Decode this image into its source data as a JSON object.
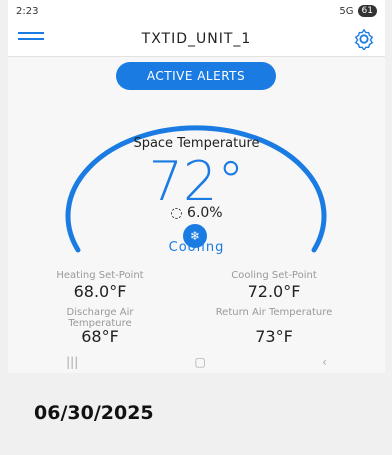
{
  "status_bar": {
    "time": "2:23",
    "signal": "5G",
    "battery": "61"
  },
  "header": {
    "title": "TXTID_UNIT_1"
  },
  "alerts_button": "ACTIVE ALERTS",
  "space": {
    "label": "Space Temperature",
    "temp": "72°",
    "humidity": "6.0%"
  },
  "mode": {
    "label": "Cooling"
  },
  "setpoints": {
    "heating_label": "Heating Set-Point",
    "heating_value": "68.0°F",
    "cooling_label": "Cooling Set-Point",
    "cooling_value": "72.0°F",
    "discharge_label": "Discharge Air Temperature",
    "discharge_value": "68°F",
    "return_label": "Return Air Temperature",
    "return_value": "73°F"
  },
  "date": "06/30/2025",
  "colors": {
    "accent": "#1a7be2"
  }
}
